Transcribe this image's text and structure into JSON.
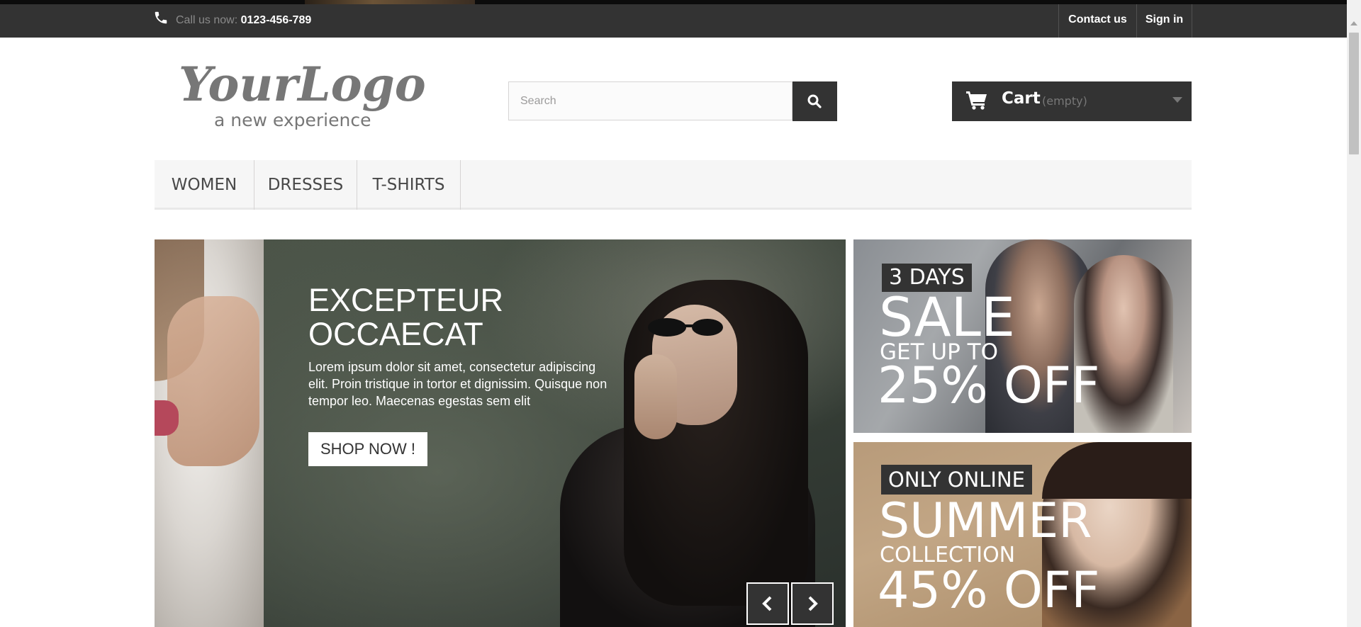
{
  "header": {
    "call_label": "Call us now:",
    "phone_number": "0123-456-789",
    "contact_label": "Contact us",
    "signin_label": "Sign in",
    "phone_icon": "phone-icon"
  },
  "logo": {
    "text": "YourLogo",
    "tagline": "a new experience"
  },
  "search": {
    "placeholder": "Search",
    "value": "",
    "icon": "search-icon"
  },
  "cart": {
    "label": "Cart",
    "status": "(empty)",
    "icon": "cart-icon"
  },
  "menu": {
    "items": [
      {
        "label": "WOMEN"
      },
      {
        "label": "DRESSES"
      },
      {
        "label": "T-SHIRTS"
      }
    ]
  },
  "slider": {
    "title_line1": "EXCEPTEUR",
    "title_line2": "OCCAECAT",
    "text": "Lorem ipsum dolor sit amet, consectetur adipiscing elit. Proin tristique in tortor et dignissim. Quisque non tempor leo. Maecenas egestas sem elit",
    "button_label": "SHOP NOW !",
    "prev_icon": "chevron-left-icon",
    "next_icon": "chevron-right-icon"
  },
  "banners": [
    {
      "tag": "3 DAYS",
      "headline": "SALE",
      "subline": "GET UP TO",
      "offer": "25% OFF"
    },
    {
      "tag": "ONLY ONLINE",
      "headline": "SUMMER",
      "subline": "COLLECTION",
      "offer": "45% OFF"
    }
  ],
  "colors": {
    "dark_bar": "#333333",
    "menu_bg": "#f6f6f6",
    "white": "#ffffff"
  }
}
